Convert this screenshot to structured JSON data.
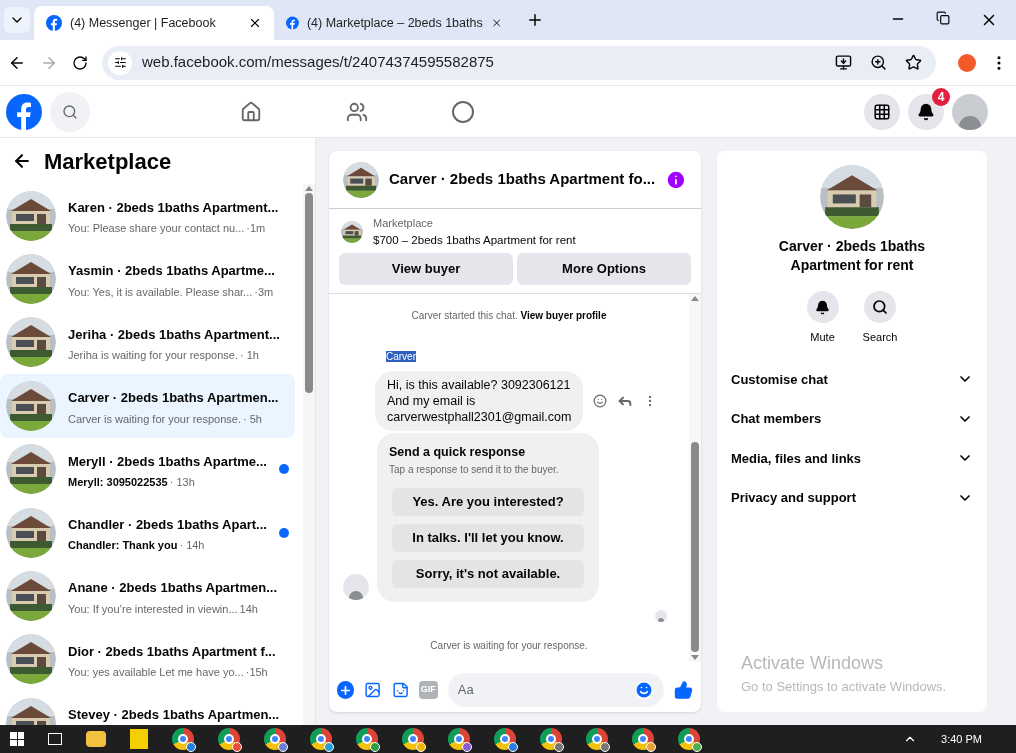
{
  "browser": {
    "tabs": [
      {
        "title": "(4) Messenger | Facebook",
        "selected": true
      },
      {
        "title": "(4) Marketplace – 2beds 1baths",
        "selected": false
      }
    ],
    "url": "web.facebook.com/messages/t/24074374595582875"
  },
  "header": {
    "notification_count": "4"
  },
  "sidebar": {
    "title": "Marketplace",
    "conversations": [
      {
        "name": "Karen · 2beds 1baths Apartment...",
        "preview": "You: Please share your contact nu...",
        "time": "·1m",
        "selected": false,
        "unread": false
      },
      {
        "name": "Yasmin · 2beds 1baths Apartme...",
        "preview": "You: Yes, it is available. Please shar...",
        "time": "·3m",
        "selected": false,
        "unread": false
      },
      {
        "name": "Jeriha · 2beds 1baths Apartment...",
        "preview": "Jeriha is waiting for your response.",
        "time": "· 1h",
        "selected": false,
        "unread": false
      },
      {
        "name": "Carver · 2beds 1baths Apartmen...",
        "preview": "Carver is waiting for your response.",
        "time": "· 5h",
        "selected": true,
        "unread": false
      },
      {
        "name": "Meryll · 2beds 1baths Apartme...",
        "preview": "Meryll: 3095022535",
        "time": "· 13h",
        "selected": false,
        "unread": true
      },
      {
        "name": "Chandler · 2beds 1baths Apart...",
        "preview": "Chandler: Thank you",
        "time": "· 14h",
        "selected": false,
        "unread": true
      },
      {
        "name": "Anane · 2beds 1baths Apartmen...",
        "preview": "You: If you’re interested in viewin...",
        "time": "14h",
        "selected": false,
        "unread": false
      },
      {
        "name": "Dior · 2beds 1baths Apartment f...",
        "preview": "You: yes available Let me have yo...",
        "time": "·15h",
        "selected": false,
        "unread": false
      },
      {
        "name": "Stevey · 2beds 1baths Apartmen...",
        "selected": false,
        "unread": false
      }
    ]
  },
  "chat": {
    "title": "Carver · 2beds 1baths Apartment fo...",
    "listing": {
      "label": "Marketplace",
      "title": "$700 – 2beds 1baths Apartment for rent"
    },
    "buttons": [
      "View buyer",
      "More Options"
    ],
    "started_note": {
      "text": "Carver started this chat.",
      "link": "View buyer profile"
    },
    "sender": {
      "name": "Carver",
      "highlighted": true
    },
    "message_lines": [
      "Hi, is this available? 3092306121",
      "And my email is",
      "carverwestphall2301@gmail.com"
    ],
    "quick_response": {
      "title": "Send a quick response",
      "subtitle": "Tap a response to send it to the buyer.",
      "options": [
        "Yes. Are you interested?",
        "In talks. I'll let you know.",
        "Sorry, it's not available."
      ]
    },
    "waiting_note": "Carver is waiting for your response.",
    "composer": {
      "placeholder": "Aa",
      "gif": "GIF"
    }
  },
  "info": {
    "title": "Carver · 2beds 1baths Apartment for rent",
    "actions": [
      {
        "label": "Mute",
        "kind": "bell"
      },
      {
        "label": "Search",
        "kind": "search"
      }
    ],
    "sections": [
      "Customise chat",
      "Chat members",
      "Media, files and links",
      "Privacy and support"
    ]
  },
  "activation": {
    "title": "Activate Windows",
    "subtitle": "Go to Settings to activate Windows."
  },
  "taskbar": {
    "time": "3:40 PM"
  }
}
